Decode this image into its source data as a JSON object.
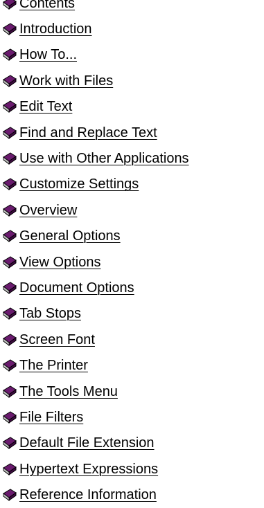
{
  "topics": [
    {
      "label": "Contents",
      "icon": "book-icon"
    },
    {
      "label": "Introduction",
      "icon": "book-icon"
    },
    {
      "label": "How To...",
      "icon": "book-icon"
    },
    {
      "label": "Work with Files",
      "icon": "book-icon"
    },
    {
      "label": "Edit Text",
      "icon": "book-icon"
    },
    {
      "label": "Find and Replace Text",
      "icon": "book-icon"
    },
    {
      "label": "Use with Other Applications",
      "icon": "book-icon"
    },
    {
      "label": "Customize Settings",
      "icon": "book-icon"
    },
    {
      "label": "Overview",
      "icon": "book-icon"
    },
    {
      "label": "General Options",
      "icon": "book-icon"
    },
    {
      "label": "View Options",
      "icon": "book-icon"
    },
    {
      "label": "Document Options",
      "icon": "book-icon"
    },
    {
      "label": "Tab Stops",
      "icon": "book-icon"
    },
    {
      "label": "Screen Font",
      "icon": "book-icon"
    },
    {
      "label": "The Printer",
      "icon": "book-icon"
    },
    {
      "label": "The Tools Menu",
      "icon": "book-icon"
    },
    {
      "label": "File Filters",
      "icon": "book-icon"
    },
    {
      "label": "Default File Extension",
      "icon": "book-icon"
    },
    {
      "label": "Hypertext Expressions",
      "icon": "book-icon"
    },
    {
      "label": "Reference Information",
      "icon": "book-icon"
    }
  ],
  "colors": {
    "book_cover": "#6a1b6e",
    "book_cover_dark": "#3d0a40",
    "book_pages": "#ffffff",
    "link_text": "#000000"
  }
}
